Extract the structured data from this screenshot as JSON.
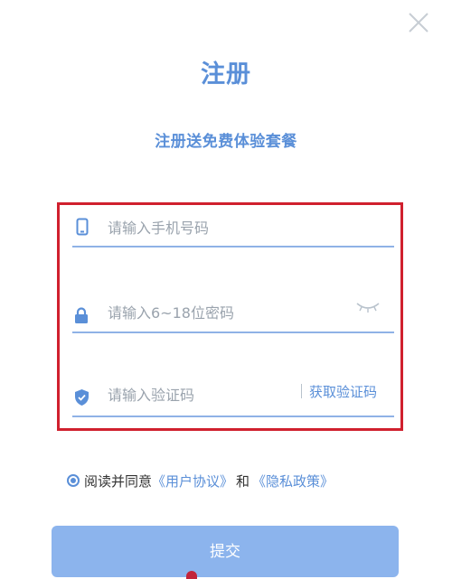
{
  "dialog": {
    "title": "注册",
    "subtitle": "注册送免费体验套餐"
  },
  "form": {
    "phone": {
      "placeholder": "请输入手机号码",
      "value": "",
      "icon": "phone-icon"
    },
    "password": {
      "placeholder": "请输入6~18位密码",
      "value": "",
      "icon": "lock-icon",
      "toggle_icon": "eye-closed-icon"
    },
    "code": {
      "placeholder": "请输入验证码",
      "value": "",
      "icon": "shield-icon",
      "get_code_label": "获取验证码"
    }
  },
  "agreement": {
    "checked": true,
    "prefix": "阅读并同意",
    "user_agreement": "《用户协议》",
    "connector": "和",
    "privacy_policy": "《隐私政策》"
  },
  "submit": {
    "label": "提交"
  },
  "colors": {
    "accent": "#5a8fd8",
    "button": "#8cb4ed",
    "highlight_border": "#d0202e",
    "underline": "#8fb2e6"
  }
}
